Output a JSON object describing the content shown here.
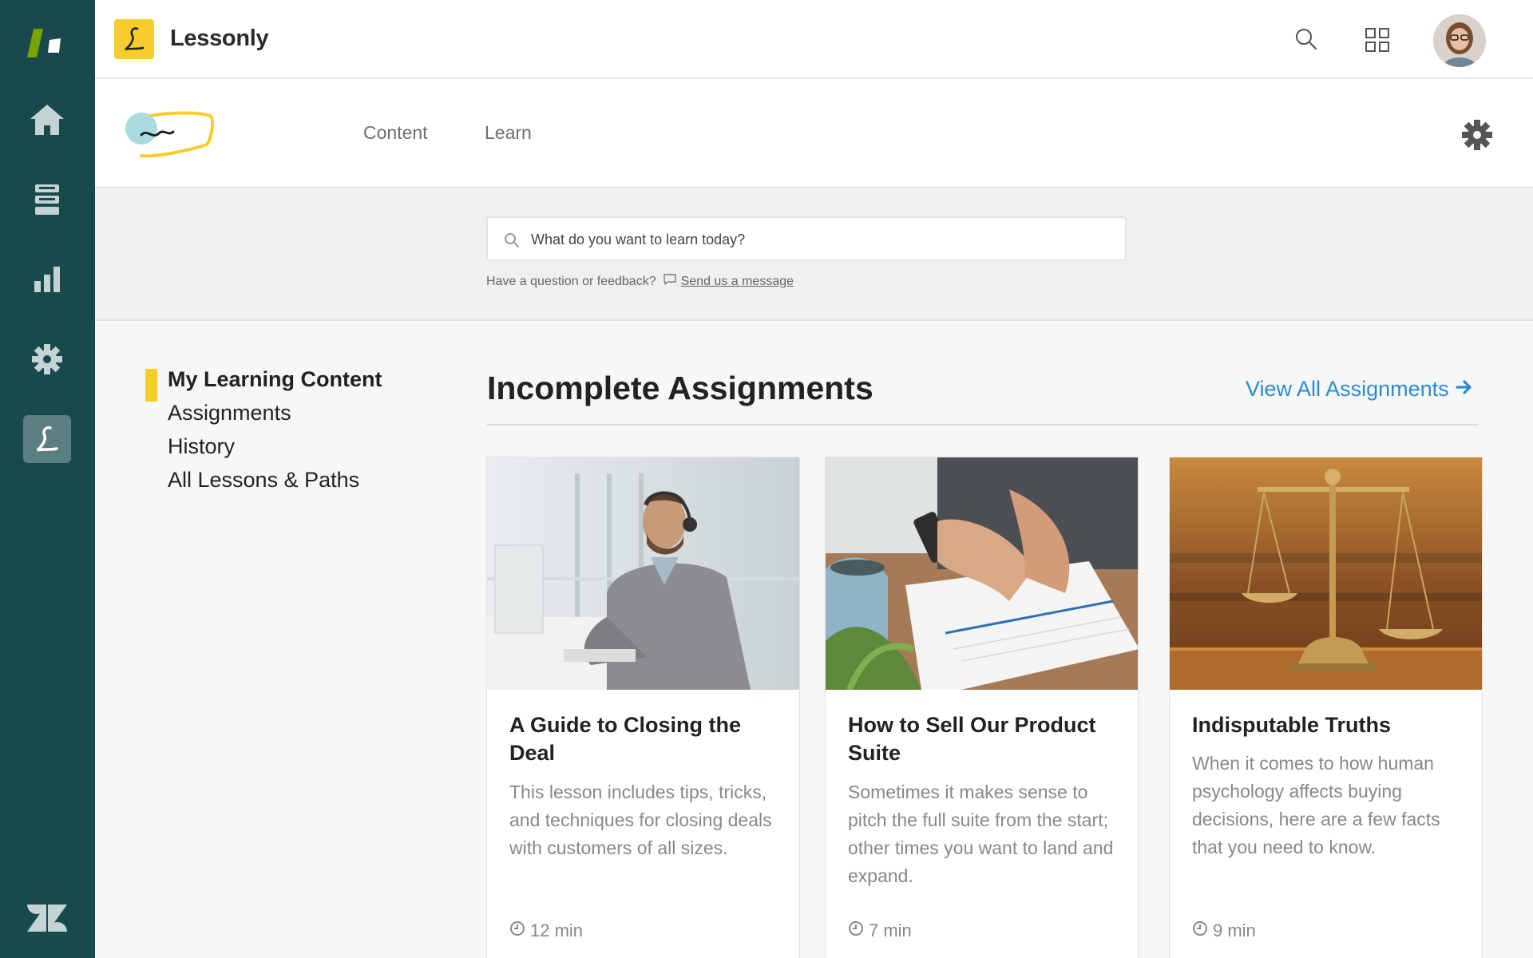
{
  "app": {
    "name": "Lessonly"
  },
  "rail": {
    "items": [
      {
        "icon": "zendesk-logo-icon"
      },
      {
        "icon": "home-icon"
      },
      {
        "icon": "views-icon"
      },
      {
        "icon": "reporting-icon"
      },
      {
        "icon": "admin-gear-icon"
      },
      {
        "icon": "lessonly-app-icon",
        "active": true
      },
      {
        "icon": "zendesk-z-icon"
      }
    ]
  },
  "subnav": {
    "tabs": [
      "Content",
      "Learn"
    ]
  },
  "search": {
    "placeholder": "What do you want to learn today?",
    "feedback_text": "Have a question or feedback?",
    "feedback_link": "Send us a message"
  },
  "sidemenu": {
    "items": [
      "My Learning Content",
      "Assignments",
      "History",
      "All Lessons & Paths"
    ],
    "active_index": 0
  },
  "main": {
    "title": "Incomplete Assignments",
    "view_all": "View All Assignments"
  },
  "cards": [
    {
      "title": "A Guide to Closing the Deal",
      "description": "This lesson includes tips, tricks, and techniques for closing deals with customers of all sizes.",
      "duration": "12 min"
    },
    {
      "title": "How to Sell Our Product Suite",
      "description": "Sometimes it makes sense to pitch the full suite from the start; other times you want to land and expand.",
      "duration": "7 min"
    },
    {
      "title": "Indisputable Truths",
      "description": "When it comes to how human psychology affects buying decisions, here are a few facts that you need to know.",
      "duration": "9 min"
    }
  ],
  "colors": {
    "rail": "#17494d",
    "accent": "#f7cd2b",
    "link": "#2a8bd6"
  }
}
